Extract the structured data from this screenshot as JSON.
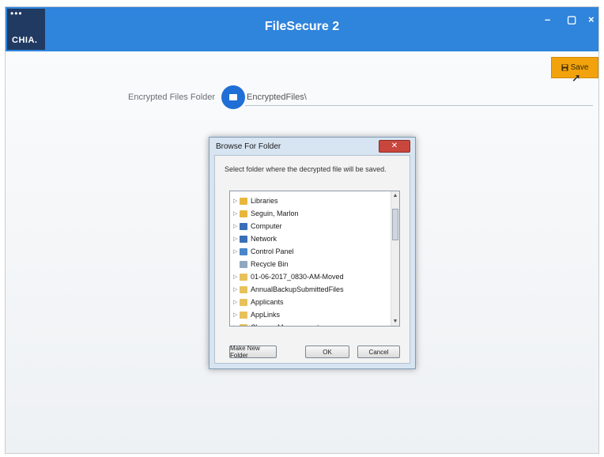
{
  "app": {
    "title": "FileSecure 2",
    "logo_dots": "•••",
    "logo_text": "CHIA."
  },
  "window_controls": {
    "minimize": "–",
    "maximize": "▢",
    "close": "×"
  },
  "toolbar": {
    "save_label": "Save",
    "save_icon": "save-icon"
  },
  "settings": {
    "folder_label": "Encrypted Files Folder",
    "folder_value": "EncryptedFiles\\"
  },
  "dialog": {
    "title": "Browse For Folder",
    "close_label": "✕",
    "instruction": "Select folder where the decrypted file will be saved.",
    "tree_items": [
      {
        "label": "Libraries",
        "icon": "libraries-icon",
        "color": "#e7b73d"
      },
      {
        "label": "Seguin, Marlon",
        "icon": "user-folder-icon",
        "color": "#e7b73d"
      },
      {
        "label": "Computer",
        "icon": "computer-icon",
        "color": "#3a6fb8"
      },
      {
        "label": "Network",
        "icon": "network-icon",
        "color": "#3a6fb8"
      },
      {
        "label": "Control Panel",
        "icon": "control-panel-icon",
        "color": "#4a86c9"
      },
      {
        "label": "Recycle Bin",
        "icon": "recycle-bin-icon",
        "color": "#8fa7c0"
      },
      {
        "label": "01-06-2017_0830-AM-Moved",
        "icon": "folder-icon",
        "color": "#e7c25a"
      },
      {
        "label": "AnnualBackupSubmittedFiles",
        "icon": "folder-icon",
        "color": "#e7c25a"
      },
      {
        "label": "Applicants",
        "icon": "folder-icon",
        "color": "#e7c25a"
      },
      {
        "label": "AppLinks",
        "icon": "folder-icon",
        "color": "#e7c25a"
      },
      {
        "label": "Change Management",
        "icon": "folder-icon",
        "color": "#e7c25a"
      }
    ],
    "buttons": {
      "make_new_folder": "Make New Folder",
      "ok": "OK",
      "cancel": "Cancel"
    }
  },
  "colors": {
    "titlebar": "#2f84dc",
    "accent_save": "#f2a20c",
    "logo_bg": "#203a62"
  }
}
